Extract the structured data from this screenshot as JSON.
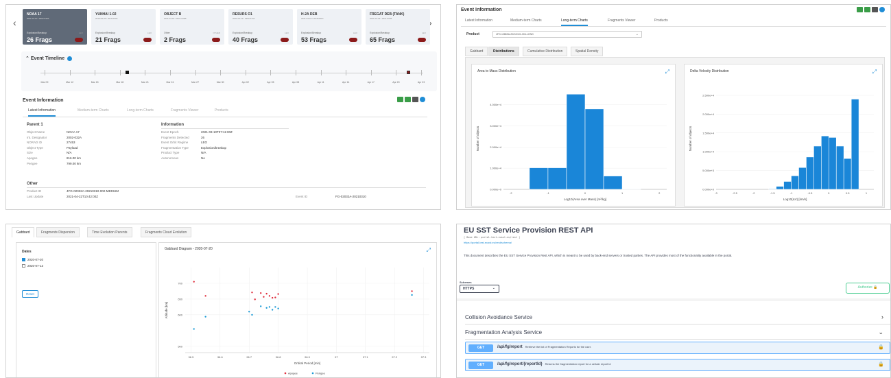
{
  "fragmentations": {
    "prev_arrow": "‹",
    "next_arrow": "›",
    "cards": [
      {
        "name": "NOAA 17",
        "date": "2021-03-10 / 2002-032A",
        "type": "Explosion/Breakup",
        "pct": "LEO",
        "frags": "26 Frags",
        "active": true
      },
      {
        "name": "YUNHAI 1-02",
        "date": "2019-09-25 / 2019-063A",
        "type": "Explosion/Breakup",
        "pct": "LEO",
        "frags": "21 Frags",
        "active": false
      },
      {
        "name": "OBJECT B",
        "date": "2021-03-18 / 2021-022B",
        "type": "Other",
        "pct": "OTHER",
        "frags": "2 Frags",
        "active": false
      },
      {
        "name": "RESURS O1",
        "date": "2021-04-12 / 1994-074A",
        "type": "Explosion/Breakup",
        "pct": "LEO",
        "frags": "40 Frags",
        "active": false
      },
      {
        "name": "H-2A DEB",
        "date": "2021-04-18 / 2018-084C",
        "type": "Explosion/Breakup",
        "pct": "LEO",
        "frags": "53 Frags",
        "active": false
      },
      {
        "name": "FREGAT DEB (TANK)",
        "date": "2021-04-23 / 2011-037B",
        "type": "Explosion/Breakup",
        "pct": "LEO",
        "frags": "65 Frags",
        "active": false
      }
    ]
  },
  "timeline": {
    "title": "Event Timeline",
    "labels": [
      "Mar 09",
      "Mar 12",
      "Mar 15",
      "Mar 18",
      "Mar 21",
      "Mar 24",
      "Mar 27",
      "Mar 30",
      "Apr 02",
      "Apr 05",
      "Apr 08",
      "Apr 11",
      "Apr 14",
      "Apr 17",
      "Apr 20",
      "Apr 23"
    ]
  },
  "event_info": {
    "title": "Event Information",
    "tabs": [
      "Latest Information",
      "Medium-term Charts",
      "Long-term Charts",
      "Fragments Viewer",
      "Products"
    ],
    "parent_heading": "Parent 1",
    "parent": [
      {
        "k": "Object Name",
        "v": "NOAA 17"
      },
      {
        "k": "Int. Designator",
        "v": "2002-032A"
      },
      {
        "k": "NORAD ID",
        "v": "27453"
      },
      {
        "k": "Object Type",
        "v": "Payload"
      },
      {
        "k": "Size",
        "v": "N/A"
      },
      {
        "k": "Apogee",
        "v": "816.00 km"
      },
      {
        "k": "Perigee",
        "v": "799.00 km"
      }
    ],
    "info_heading": "Information",
    "info": [
      {
        "k": "Event Epoch",
        "v": "2021-03-10T07:11:00Z"
      },
      {
        "k": "Fragments Detected",
        "v": "26"
      },
      {
        "k": "Event Orbit Regime",
        "v": "LEO"
      },
      {
        "k": "Fragmentation Type",
        "v": "Explosion/breakup"
      },
      {
        "k": "Product Type",
        "v": "N/A"
      },
      {
        "k": "Autonomous",
        "v": "No"
      }
    ],
    "other_heading": "Other",
    "other": [
      {
        "k": "Product ID",
        "v": "4FG-02032A-20210310-002-MEDIUM"
      },
      {
        "k": "Last Update",
        "v": "2021-04-22T10:42:00Z"
      }
    ],
    "event_id_label": "Event ID",
    "event_id_value": "FG-02032A-20210310"
  },
  "longterm": {
    "title": "Event Information",
    "tabs": [
      "Latest Information",
      "Medium-term Charts",
      "Long-term Charts",
      "Fragments Viewer",
      "Products"
    ],
    "product_label": "Product",
    "product_value": "4FG-10869A-20210101-004-LONG",
    "subtabs": [
      "Gabbard",
      "Distributions",
      "Cumulative Distribution",
      "Spatial Density"
    ]
  },
  "gabbard_panel": {
    "tabs": [
      "Gabbard",
      "Fragments Dispersion",
      "Time Evolution Parents",
      "Fragments Cloud Evolution"
    ],
    "dates_heading": "Dates",
    "dates": [
      {
        "label": "2020-07-20",
        "checked": true
      },
      {
        "label": "2020-07-13",
        "checked": false
      }
    ],
    "reset_label": "Reset",
    "chart_title": "Gabbard Diagram - 2020-07-20"
  },
  "api": {
    "title": "EU SST Service Provision REST API",
    "base_url": "[ Base URL: portal-test.eusst.eu/rest ]",
    "schema_link": "https://portal-test.eusst.eu/rest/schema/",
    "description": "This document describes the EU SST Service Provision Rest API, which is meant to be used by back-end servers or trusted parties. The API provides most of the functionality available in the portal.",
    "schemes_label": "Schemes",
    "scheme_value": "HTTPS",
    "authorize_label": "Authorize",
    "services": [
      "Collision Avoidance Service",
      "Fragmentation Analysis Service"
    ],
    "operations": [
      {
        "method": "GET",
        "path": "/api/fg/report",
        "desc": "Retrieve the list of Fragmentation Reports for the user."
      },
      {
        "method": "GET",
        "path": "/api/fg/report/{reportId}",
        "desc": "Returns the fragmentation report for a certain report id"
      }
    ]
  },
  "chart_data": [
    {
      "type": "bar",
      "title": "Area to Mass Distribution",
      "xlabel": "Log10(Area over Mass) [m²/kg]",
      "ylabel": "Number of objects",
      "x_ticks": [
        "-2",
        "-1",
        "0",
        "1",
        "2"
      ],
      "xlim": [
        -2.2,
        2.2
      ],
      "y_ticks": [
        "0.000e+0",
        "1.000e+4",
        "2.000e+4",
        "3.000e+4",
        "4.000e+4"
      ],
      "ylim": [
        0,
        48000
      ],
      "bins": [
        {
          "x0": -1.5,
          "x1": -1.0,
          "value": 10200
        },
        {
          "x0": -1.0,
          "x1": -0.5,
          "value": 10200
        },
        {
          "x0": -0.5,
          "x1": 0.0,
          "value": 45000
        },
        {
          "x0": 0.0,
          "x1": 0.5,
          "value": 38000
        },
        {
          "x0": 0.5,
          "x1": 1.0,
          "value": 6300
        },
        {
          "x0": 1.0,
          "x1": 1.5,
          "value": 200
        }
      ],
      "color": "#1a86d8"
    },
    {
      "type": "bar",
      "title": "Delta Velocity Distribution",
      "xlabel": "Log10(ΔV) [km/s]",
      "ylabel": "Number of objects",
      "x_ticks": [
        "-3",
        "-2.5",
        "-2",
        "-1.5",
        "-1",
        "-0.5",
        "0",
        "0.5",
        "1"
      ],
      "xlim": [
        -3.0,
        1.2
      ],
      "y_ticks": [
        "0.000e+0",
        "5.000e+3",
        "1.000e+4",
        "1.500e+4",
        "2.000e+4",
        "2.500e+4"
      ],
      "ylim": [
        0,
        27000
      ],
      "bins": [
        {
          "x0": -1.6,
          "x1": -1.4,
          "value": 150
        },
        {
          "x0": -1.4,
          "x1": -1.2,
          "value": 800
        },
        {
          "x0": -1.2,
          "x1": -1.0,
          "value": 2100
        },
        {
          "x0": -1.0,
          "x1": -0.8,
          "value": 3600
        },
        {
          "x0": -0.8,
          "x1": -0.6,
          "value": 5800
        },
        {
          "x0": -0.6,
          "x1": -0.4,
          "value": 8600
        },
        {
          "x0": -0.4,
          "x1": -0.2,
          "value": 11500
        },
        {
          "x0": -0.2,
          "x1": 0.0,
          "value": 14200
        },
        {
          "x0": 0.0,
          "x1": 0.2,
          "value": 13800
        },
        {
          "x0": 0.2,
          "x1": 0.4,
          "value": 11500
        },
        {
          "x0": 0.4,
          "x1": 0.6,
          "value": 8200
        },
        {
          "x0": 0.6,
          "x1": 0.8,
          "value": 24000
        }
      ],
      "color": "#1a86d8"
    },
    {
      "type": "scatter",
      "title": "Gabbard Diagram - 2020-07-20",
      "xlabel": "Orbital Period [min]",
      "ylabel": "Altitude [km]",
      "x_ticks": [
        "96.5",
        "96.6",
        "96.7",
        "96.8",
        "96.9",
        "97",
        "97.1",
        "97.2",
        "97.3"
      ],
      "xlim": [
        96.48,
        97.32
      ],
      "y_ticks": [
        "500",
        "600",
        "650",
        "700"
      ],
      "ylim": [
        480,
        750
      ],
      "series": [
        {
          "name": "Apogee",
          "color": "#e0303f",
          "points": [
            [
              96.51,
              705
            ],
            [
              96.55,
              660
            ],
            [
              96.71,
              671
            ],
            [
              96.72,
              649
            ],
            [
              96.74,
              669
            ],
            [
              96.75,
              657
            ],
            [
              96.76,
              667
            ],
            [
              96.77,
              660
            ],
            [
              96.78,
              654
            ],
            [
              96.79,
              655
            ],
            [
              96.8,
              666
            ],
            [
              97.26,
              675
            ]
          ]
        },
        {
          "name": "Perigee",
          "color": "#1a9ad6",
          "points": [
            [
              96.51,
              555
            ],
            [
              96.55,
              594
            ],
            [
              96.7,
              610
            ],
            [
              96.71,
              600
            ],
            [
              96.74,
              627
            ],
            [
              96.76,
              622
            ],
            [
              96.77,
              625
            ],
            [
              96.78,
              616
            ],
            [
              96.79,
              625
            ],
            [
              96.8,
              620
            ],
            [
              97.26,
              663
            ]
          ]
        }
      ]
    }
  ]
}
